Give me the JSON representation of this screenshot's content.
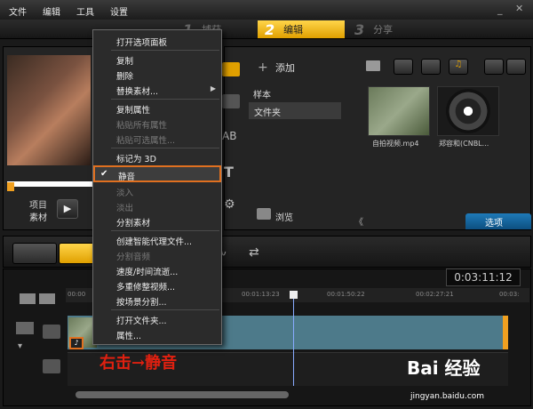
{
  "menubar": {
    "file": "文件",
    "edit": "编辑",
    "tools": "工具",
    "settings": "设置"
  },
  "steps": [
    {
      "num": "1",
      "label": "捕获"
    },
    {
      "num": "2",
      "label": "编辑"
    },
    {
      "num": "3",
      "label": "分享"
    }
  ],
  "preview": {
    "project_label": "项目",
    "clip_label": "素材",
    "play": "▶"
  },
  "library": {
    "add": "添加",
    "sample": "样本",
    "folder": "文件夹",
    "browse": "浏览",
    "options": "选项",
    "items": [
      {
        "caption": "自拍视频.mp4"
      },
      {
        "caption": "郑容和(CNBL..."
      }
    ]
  },
  "timeline": {
    "timecode": "0:03:11:12",
    "ticks": [
      "00:00",
      "00:01:13:23",
      "00:01:50:22",
      "00:02:27:21",
      "00:03:"
    ]
  },
  "context_menu": {
    "items": [
      {
        "label": "打开选项面板",
        "disabled": false
      },
      {
        "label": "复制",
        "disabled": false
      },
      {
        "label": "删除",
        "disabled": false
      },
      {
        "label": "替换素材...",
        "disabled": false,
        "submenu": true
      },
      {
        "label": "复制属性",
        "disabled": false
      },
      {
        "label": "粘贴所有属性",
        "disabled": true
      },
      {
        "label": "粘贴可选属性...",
        "disabled": true
      },
      {
        "label": "标记为 3D",
        "disabled": false
      },
      {
        "label": "静音",
        "disabled": false,
        "checked": true
      },
      {
        "label": "淡入",
        "disabled": true
      },
      {
        "label": "淡出",
        "disabled": true
      },
      {
        "label": "分割素材",
        "disabled": false
      },
      {
        "label": "创建智能代理文件...",
        "disabled": false
      },
      {
        "label": "分割音频",
        "disabled": true
      },
      {
        "label": "速度/时间流逝...",
        "disabled": false
      },
      {
        "label": "多重修整视频...",
        "disabled": false
      },
      {
        "label": "按场景分割...",
        "disabled": false
      },
      {
        "label": "打开文件夹...",
        "disabled": false
      },
      {
        "label": "属性...",
        "disabled": false
      }
    ]
  },
  "annotation": "右击→静音",
  "watermark": {
    "brand": "Bai 经验",
    "url": "jingyan.baidu.com"
  },
  "colors": {
    "accent": "#e0a000",
    "highlight_border": "#e07020",
    "option_blue": "#1f7ab8",
    "annotation_red": "#e02010"
  }
}
